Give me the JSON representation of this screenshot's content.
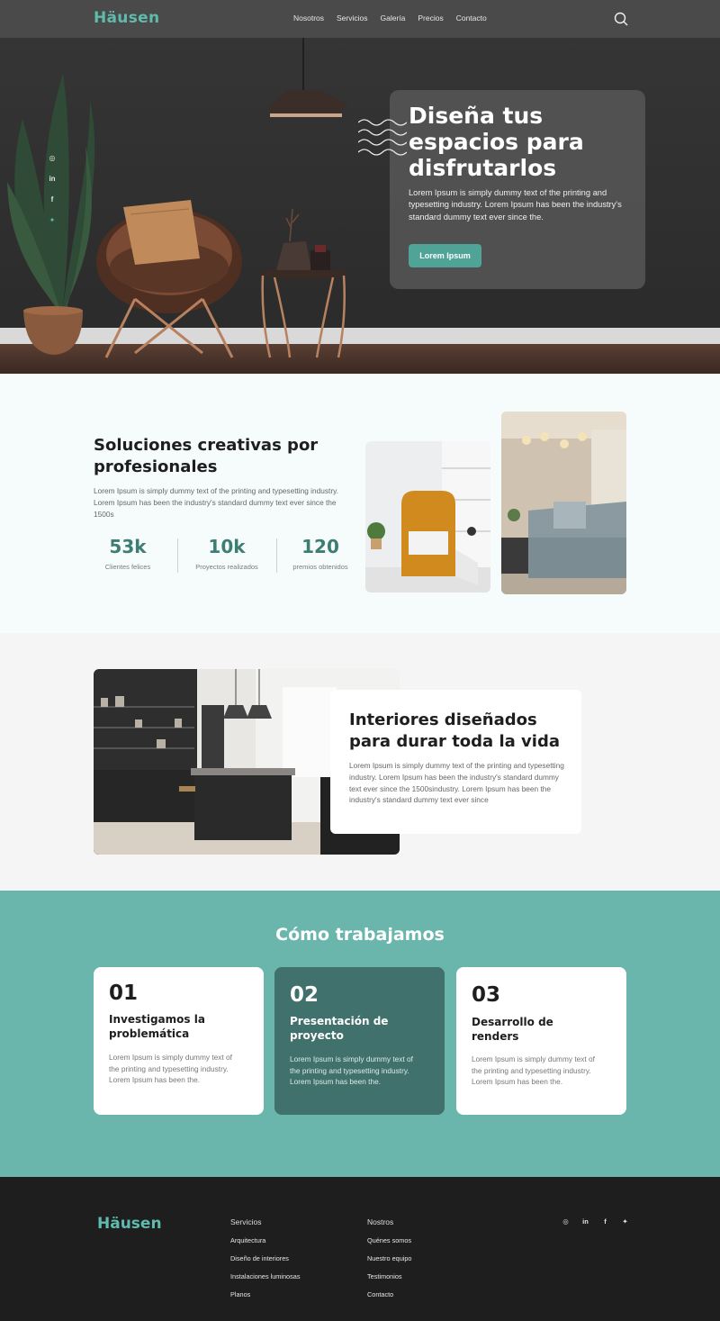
{
  "brand": {
    "name": "Häusen",
    "accent": "#5fbbad",
    "dark_teal": "#41716c",
    "teal_bg": "#6ab6ad",
    "button": "#4fa497"
  },
  "nav": {
    "links": [
      "Nosotros",
      "Servicios",
      "Galería",
      "Precios",
      "Contacto"
    ],
    "search_icon": "search-icon"
  },
  "hero": {
    "social": [
      "instagram-icon",
      "linkedin-icon",
      "facebook-icon",
      "twitter-icon"
    ],
    "social_glyphs": [
      "◎",
      "in",
      "f",
      "✦"
    ],
    "title": "Diseña tus espacios para disfrutarlos",
    "text": "Lorem Ipsum is simply dummy text of the printing and typesetting industry. Lorem Ipsum has been the industry's standard dummy text ever since the.",
    "button": "Lorem Ipsum"
  },
  "solutions": {
    "title": "Soluciones creativas por profesionales",
    "text": "Lorem Ipsum is simply dummy text of the printing and typesetting industry. Lorem Ipsum has been the industry's standard dummy text ever since the 1500s",
    "stats": [
      {
        "value": "53k",
        "label": "Clientes felices"
      },
      {
        "value": "10k",
        "label": "Proyectos realizados"
      },
      {
        "value": "120",
        "label": "premios obtenidos"
      }
    ]
  },
  "interiors": {
    "title": "Interiores diseñados para durar toda la vida",
    "text": "Lorem Ipsum is simply dummy text of the printing and typesetting industry. Lorem Ipsum has been the industry's standard dummy text ever since the 1500sindustry. Lorem Ipsum has been the industry's standard dummy text ever since"
  },
  "work": {
    "title": "Cómo trabajamos",
    "cards": [
      {
        "number": "01",
        "title": "Investigamos la problemática",
        "text": "Lorem Ipsum is simply dummy text of the printing and typesetting industry. Lorem Ipsum has been the."
      },
      {
        "number": "02",
        "title": "Presentación de proyecto",
        "text": "Lorem Ipsum is simply dummy text of the printing and typesetting industry. Lorem Ipsum has been the."
      },
      {
        "number": "03",
        "title": "Desarrollo de renders",
        "text": "Lorem Ipsum is simply dummy text of the printing and typesetting industry. Lorem Ipsum has been the."
      }
    ]
  },
  "footer": {
    "services_title": "Servicios",
    "services": [
      "Arquitectura",
      "Diseño de interiores",
      "Instalaciones luminosas",
      "Planos"
    ],
    "about_title": "Nostros",
    "about": [
      "Quénes somos",
      "Nuestro equipo",
      "Testimonios",
      "Contacto"
    ],
    "social_glyphs": [
      "◎",
      "in",
      "f",
      "✦"
    ]
  }
}
